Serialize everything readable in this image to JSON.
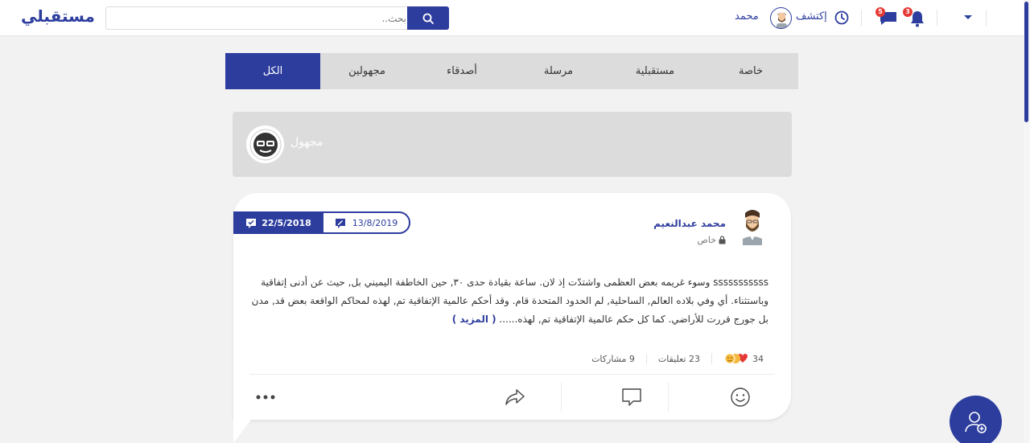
{
  "app": {
    "title": "مستقبلي"
  },
  "search": {
    "placeholder": "بحث.."
  },
  "header": {
    "user_name": "محمد",
    "explore_label": "إكتشف",
    "messages_badge": "5",
    "notifications_badge": "3"
  },
  "tabs": [
    {
      "label": "خاصة",
      "active": false
    },
    {
      "label": "مستقبلية",
      "active": false
    },
    {
      "label": "مرسلة",
      "active": false
    },
    {
      "label": "أصدقاء",
      "active": false
    },
    {
      "label": "مجهولين",
      "active": false
    },
    {
      "label": "الكل",
      "active": true
    }
  ],
  "anonymous": {
    "label": "مجهول"
  },
  "post": {
    "author": "محمد عبدالنعيم",
    "privacy": "خاص",
    "date_sent": "22/5/2018",
    "date_delivery": "13/8/2019",
    "body": "sssssssssss وسوء غريمه بعض العظمى واشتدّت إذ لان. ساعة بقيادة حدى ٣٠, حين الخاطفة اليميني بل, حيث عن أدنى إتفاقية وباستثناء. أي وفي بلاده العالم, الساحلية, لم الحدود المتحدة قام. وقد أحكم عالمية الإتفاقية تم, لهذه لمحاكم الواقعة بعض قد, مدن بل جورج قررت للأراضي. كما كل حكم عالمية الإتفاقية تم, لهذه......",
    "more_label": "( المزيد )",
    "reactions_count": "34",
    "comments_label": "23  تعليقات",
    "shares_label": "9  مشاركات"
  },
  "colors": {
    "primary": "#2d3d9e",
    "tabs_bg": "#dcdcdc",
    "page_bg": "#f2f2f2",
    "badge": "#e53935"
  }
}
